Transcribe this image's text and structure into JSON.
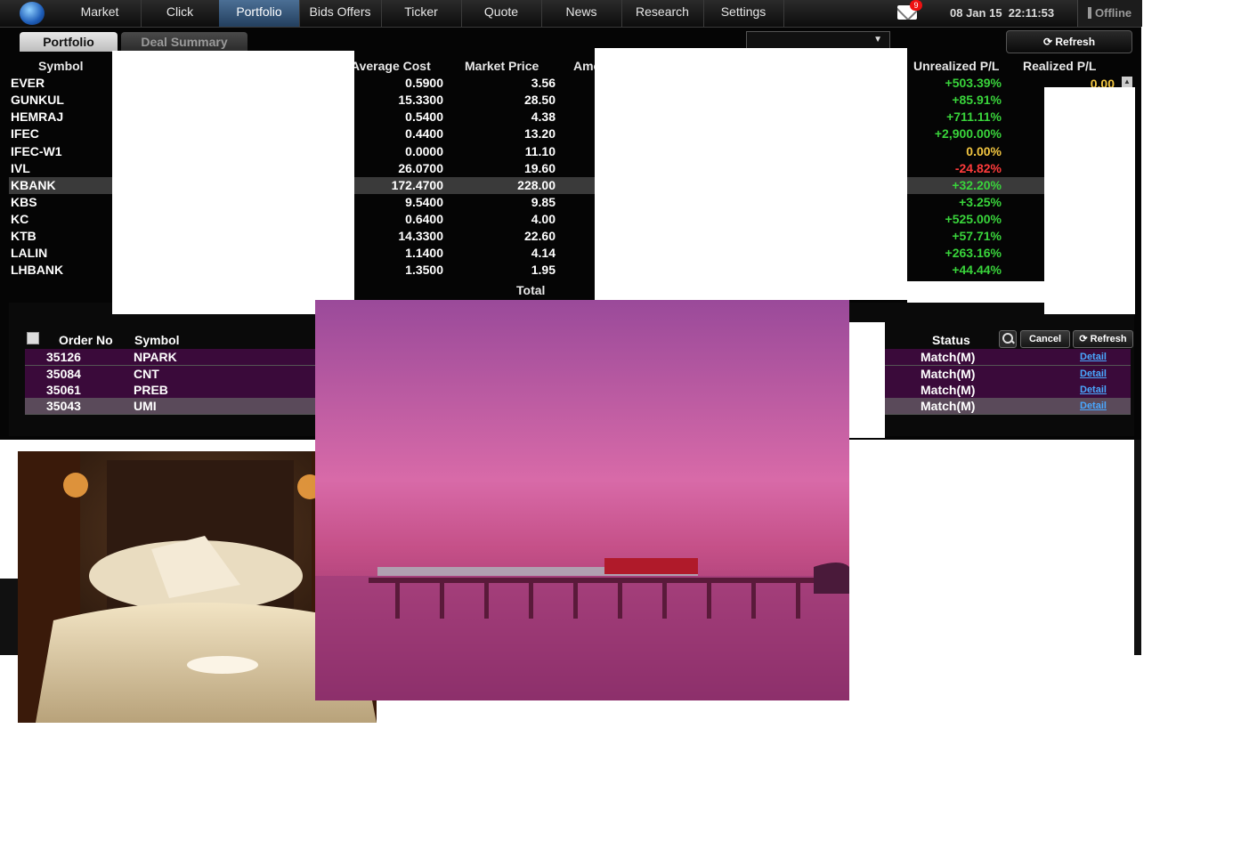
{
  "nav": {
    "tabs": [
      "Market",
      "Click",
      "Portfolio",
      "Bids Offers",
      "Ticker",
      "Quote",
      "News",
      "Research",
      "Settings"
    ],
    "mail_count": "9",
    "date": "08 Jan 15",
    "time": "22:11:53",
    "status": "Offline"
  },
  "subtabs": {
    "portfolio": "Portfolio",
    "deal_summary": "Deal Summary"
  },
  "refresh_label": "Refresh",
  "portfolio": {
    "headers": {
      "symbol": "Symbol",
      "avg": "Average Cost",
      "mkt": "Market Price",
      "amount": "Amo",
      "unrealized": "Unrealized P/L",
      "realized": "Realized P/L"
    },
    "rows": [
      {
        "symbol": "EVER",
        "avg": "0.5900",
        "mkt": "3.56",
        "unr": "+503.39%"
      },
      {
        "symbol": "GUNKUL",
        "avg": "15.3300",
        "mkt": "28.50",
        "unr": "+85.91%"
      },
      {
        "symbol": "HEMRAJ",
        "avg": "0.5400",
        "mkt": "4.38",
        "unr": "+711.11%"
      },
      {
        "symbol": "IFEC",
        "avg": "0.4400",
        "mkt": "13.20",
        "unr": "+2,900.00%"
      },
      {
        "symbol": "IFEC-W1",
        "avg": "0.0000",
        "mkt": "11.10",
        "unr": "0.00%"
      },
      {
        "symbol": "IVL",
        "avg": "26.0700",
        "mkt": "19.60",
        "unr": "-24.82%"
      },
      {
        "symbol": "KBANK",
        "avg": "172.4700",
        "mkt": "228.00",
        "unr": "+32.20%"
      },
      {
        "symbol": "KBS",
        "avg": "9.5400",
        "mkt": "9.85",
        "unr": "+3.25%"
      },
      {
        "symbol": "KC",
        "avg": "0.6400",
        "mkt": "4.00",
        "unr": "+525.00%"
      },
      {
        "symbol": "KTB",
        "avg": "14.3300",
        "mkt": "22.60",
        "unr": "+57.71%"
      },
      {
        "symbol": "LALIN",
        "avg": "1.1400",
        "mkt": "4.14",
        "unr": "+263.16%"
      },
      {
        "symbol": "LHBANK",
        "avg": "1.3500",
        "mkt": "1.95",
        "unr": "+44.44%"
      }
    ],
    "realized_first": "0.00",
    "total_label": "Total"
  },
  "orders": {
    "headers": {
      "order_no": "Order No",
      "symbol": "Symbol",
      "status": "Status"
    },
    "buttons": {
      "cancel": "Cancel",
      "refresh": "Refresh"
    },
    "detail_label": "Detail",
    "rows": [
      {
        "no": "35126",
        "symbol": "NPARK",
        "status": "Match(M)"
      },
      {
        "no": "35084",
        "symbol": "CNT",
        "status": "Match(M)"
      },
      {
        "no": "35061",
        "symbol": "PREB",
        "status": "Match(M)"
      },
      {
        "no": "35043",
        "symbol": "UMI",
        "status": "Match(M)"
      }
    ]
  },
  "colors": {
    "positive": "#39d43b",
    "negative": "#ff3b3b",
    "zero": "#f2c641",
    "accent": "#3f6187"
  }
}
